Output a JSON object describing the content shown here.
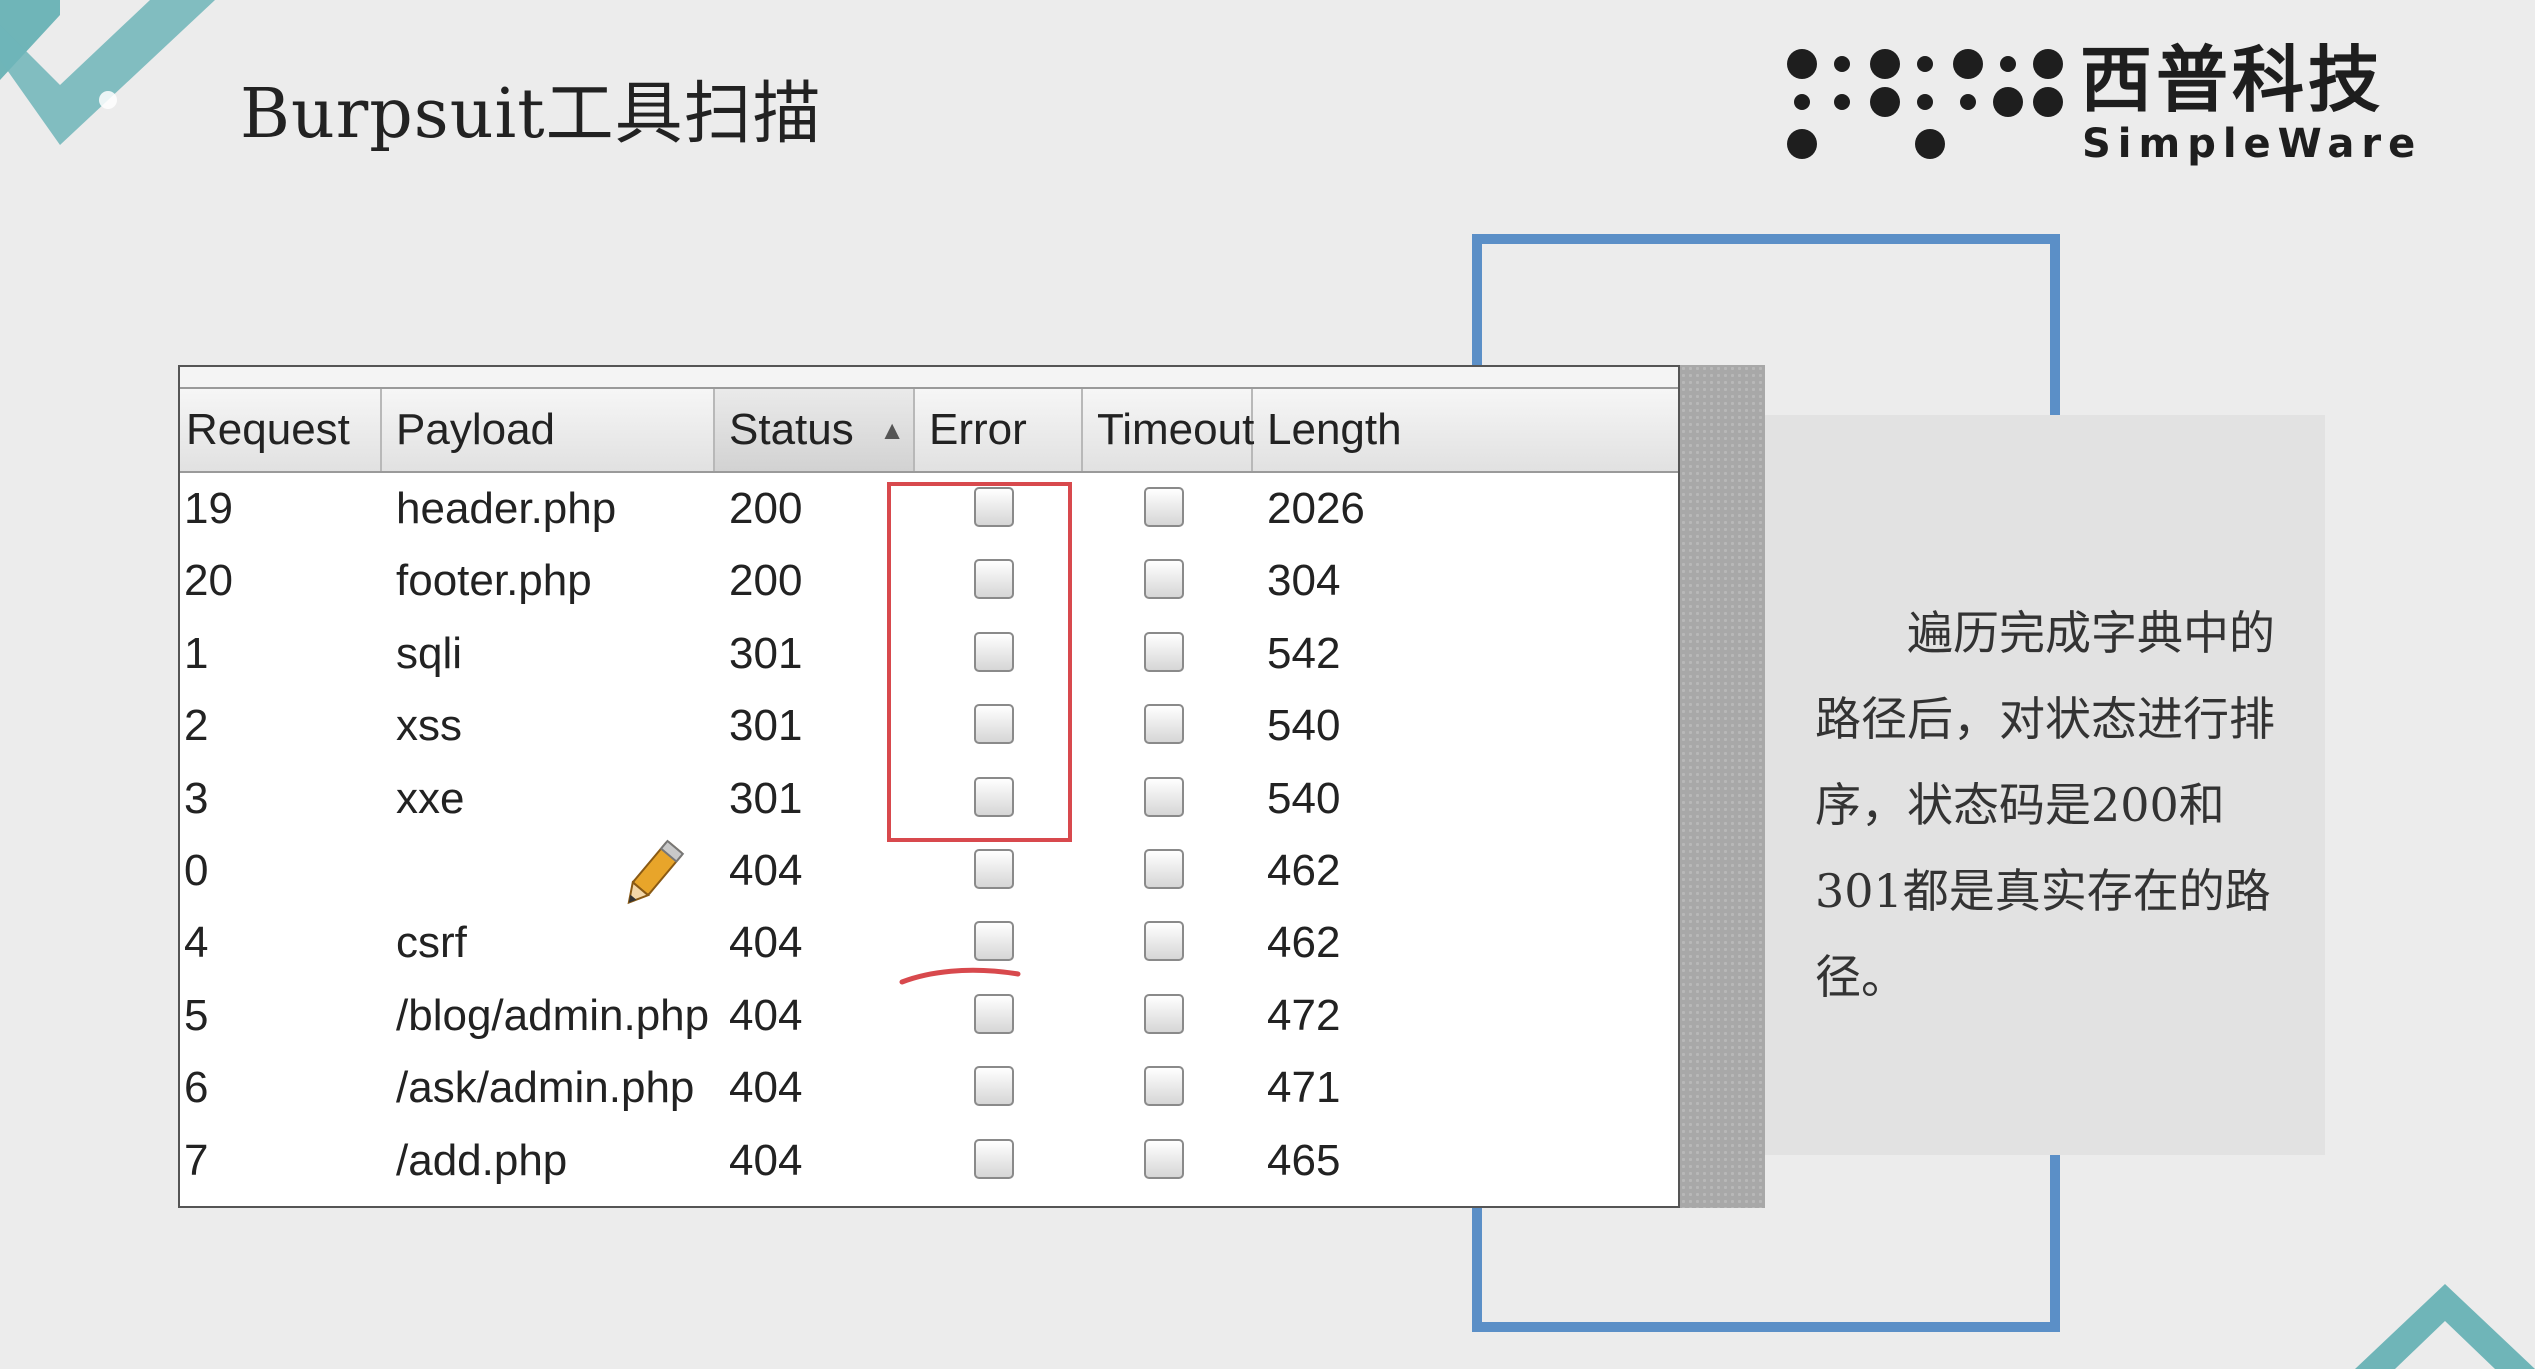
{
  "slide": {
    "title": "Burpsuit工具扫描"
  },
  "logo": {
    "cn": "西普科技",
    "en": "SimpleWare"
  },
  "note": {
    "text": "遍历完成字典中的路径后，对状态进行排序，状态码是200和301都是真实存在的路径。"
  },
  "table": {
    "columns": [
      "Request",
      "Payload",
      "Status",
      "Error",
      "Timeout",
      "Length"
    ],
    "sorted_column": "Status",
    "sort_direction": "ascending",
    "rows": [
      {
        "request": "19",
        "payload": "header.php",
        "status": "200",
        "error": false,
        "timeout": false,
        "length": "2026"
      },
      {
        "request": "20",
        "payload": "footer.php",
        "status": "200",
        "error": false,
        "timeout": false,
        "length": "304"
      },
      {
        "request": "1",
        "payload": "sqli",
        "status": "301",
        "error": false,
        "timeout": false,
        "length": "542"
      },
      {
        "request": "2",
        "payload": "xss",
        "status": "301",
        "error": false,
        "timeout": false,
        "length": "540"
      },
      {
        "request": "3",
        "payload": "xxe",
        "status": "301",
        "error": false,
        "timeout": false,
        "length": "540"
      },
      {
        "request": "0",
        "payload": "",
        "status": "404",
        "error": false,
        "timeout": false,
        "length": "462"
      },
      {
        "request": "4",
        "payload": "csrf",
        "status": "404",
        "error": false,
        "timeout": false,
        "length": "462"
      },
      {
        "request": "5",
        "payload": "/blog/admin.php",
        "status": "404",
        "error": false,
        "timeout": false,
        "length": "472"
      },
      {
        "request": "6",
        "payload": "/ask/admin.php",
        "status": "404",
        "error": false,
        "timeout": false,
        "length": "471"
      },
      {
        "request": "7",
        "payload": "/add.php",
        "status": "404",
        "error": false,
        "timeout": false,
        "length": "465"
      }
    ]
  },
  "colors": {
    "frame_blue": "#5b8fc7",
    "highlight_red": "#d8494d",
    "corner_teal": "#6fb5b8"
  }
}
